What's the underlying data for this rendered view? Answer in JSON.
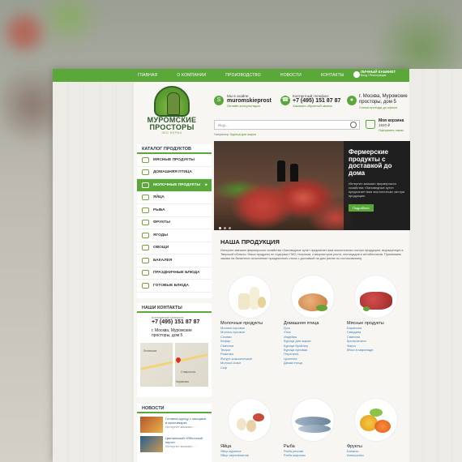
{
  "nav": {
    "items": [
      "Главная",
      "О компании",
      "Производство",
      "Новости",
      "Контакты"
    ],
    "cabinet_title": "Личный кабинет",
    "cabinet_sub": "Вход / Регистрация"
  },
  "logo": {
    "line1": "МУРОМСКИЕ",
    "line2": "ПРОСТОРЫ",
    "tagline": "ЭКО ФЕРМА"
  },
  "header": {
    "skype_label": "Мы в скайпе:",
    "skype_value": "muromskieprost",
    "skype_link": "Онлайн-консультация",
    "phone_label": "Контактный телефон:",
    "phone_value": "+7 (495) 151 87 87",
    "phone_link": "Заказать обратный звонок",
    "address_value": "г. Москва, Муромские просторы, дом 5",
    "address_link": "Схема проезда до офиса",
    "cart_title": "Моя корзина",
    "cart_sum": "1920 ₽",
    "cart_link": "Оформить заказ"
  },
  "search": {
    "placeholder": "Ищу..."
  },
  "breadcrumb": {
    "home": "Например:",
    "item": "Курица для жарки"
  },
  "catalog": {
    "title": "Каталог продуктов",
    "items": [
      {
        "label": "Мясные продукты",
        "active": false
      },
      {
        "label": "Домашняя птица",
        "active": false
      },
      {
        "label": "Молочные продукты",
        "active": true
      },
      {
        "label": "Яйца",
        "active": false
      },
      {
        "label": "Рыба",
        "active": false
      },
      {
        "label": "Фрукты",
        "active": false
      },
      {
        "label": "Ягоды",
        "active": false
      },
      {
        "label": "Овощи",
        "active": false
      },
      {
        "label": "Бакалея",
        "active": false
      },
      {
        "label": "Праздничные блюда",
        "active": false
      },
      {
        "label": "Готовые блюда",
        "active": false
      }
    ]
  },
  "contacts": {
    "title": "Наши контакты",
    "phone_label": "Контактный телефон:",
    "phone": "+7 (495) 151 87 87",
    "address": "г. Москва, Муромские просторы, дом 5",
    "map_labels": [
      "Ставрополь",
      "Ленинская",
      "Кировская"
    ]
  },
  "news": {
    "title": "Новости",
    "items": [
      {
        "title": "Готовим курицу с овощами в мультиварке",
        "sub": "Интернет-магазин..."
      },
      {
        "title": "Цветаевский «Яблочный пирог»",
        "sub": "Интернет-магазин..."
      }
    ]
  },
  "banner": {
    "title": "Фермерские продукты с доставкой до дома",
    "text": "Интернет-магазин фермерского хозяйства «Заповедные кути» предлагает вам экологически чистую продукцию.",
    "button": "Подробнее"
  },
  "products": {
    "title": "Наша продукция",
    "description": "Интернет-магазин фермерского хозяйства «Заповедные кути» предлагает вам экологически чистую продукцию, выращенную в Тверской области. Наши продукты не содержат ГМО, нитратов, стимуляторов роста, пестицидов и антибиотиков. Принимаем заказы на банкетное исполнение праздничного стола с доставкой на дом (меню по согласованию).",
    "categories": [
      {
        "name": "Молочные продукты",
        "items": [
          "Молоко коровье",
          "Молоко пуховое",
          "Сливки",
          "Кефир",
          "Сметана",
          "Творог",
          "Ряженка",
          "Йогурт классический",
          "Молоко козье",
          "Сыр"
        ]
      },
      {
        "name": "Домашняя птица",
        "items": [
          "Гусь",
          "Утка",
          "Индейка",
          "Курица для жарки",
          "Курица бройлер",
          "Курица суповая",
          "Перепела",
          "Цыплята",
          "Дикая птица"
        ]
      },
      {
        "name": "Мясные продукты",
        "items": [
          "Баранина",
          "Говядина",
          "Свинина",
          "Крольчатина",
          "Фарш",
          "Мясо в маринаде"
        ]
      },
      {
        "name": "Яйца",
        "items": [
          "Яйцо куриное",
          "Яйцо перепелиное"
        ]
      },
      {
        "name": "Рыба",
        "items": [
          "Рыба речная",
          "Рыба морская"
        ]
      },
      {
        "name": "Фрукты",
        "items": [
          "Бананы",
          "Апельсины"
        ]
      }
    ]
  },
  "colors": {
    "accent": "#5aa83a",
    "dark": "#2c5a2a",
    "link": "#3d7fb5"
  }
}
